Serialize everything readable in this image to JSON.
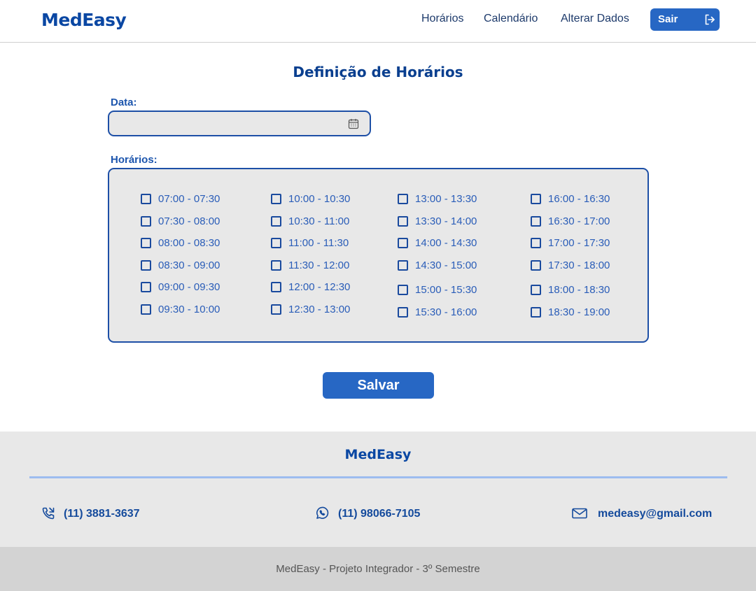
{
  "header": {
    "logo": "MedEasy",
    "nav": [
      "Horários",
      "Calendário",
      "Alterar Dados"
    ],
    "logout_label": "Sair"
  },
  "page": {
    "title": "Definição de Horários",
    "date_label": "Data:",
    "date_value": "",
    "slots_label": "Horários:",
    "save_label": "Salvar"
  },
  "slots": [
    [
      "07:00 - 07:30",
      "07:30 - 08:00",
      "08:00 - 08:30",
      "08:30 - 09:00",
      "09:00 - 09:30",
      "09:30 - 10:00"
    ],
    [
      "10:00 - 10:30",
      "10:30 - 11:00",
      "11:00 - 11:30",
      "11:30 - 12:00",
      "12:00 - 12:30",
      "12:30 - 13:00"
    ],
    [
      "13:00 - 13:30",
      "13:30 - 14:00",
      "14:00 - 14:30",
      "14:30 - 15:00",
      "15:00 - 15:30",
      "15:30 - 16:00"
    ],
    [
      "16:00 - 16:30",
      "16:30 - 17:00",
      "17:00 - 17:30",
      "17:30 - 18:00",
      "18:00 - 18:30",
      "18:30 - 19:00"
    ]
  ],
  "footer": {
    "logo": "MedEasy",
    "phone": "(11) 3881-3637",
    "whatsapp": "(11) 98066-7105",
    "email": "medeasy@gmail.com",
    "credit": "MedEasy - Projeto Integrador - 3º Semestre"
  },
  "colors": {
    "brand": "#0a47a3",
    "button": "#2767c4",
    "panel": "#e8e8e8",
    "border": "#1d4fa6"
  }
}
